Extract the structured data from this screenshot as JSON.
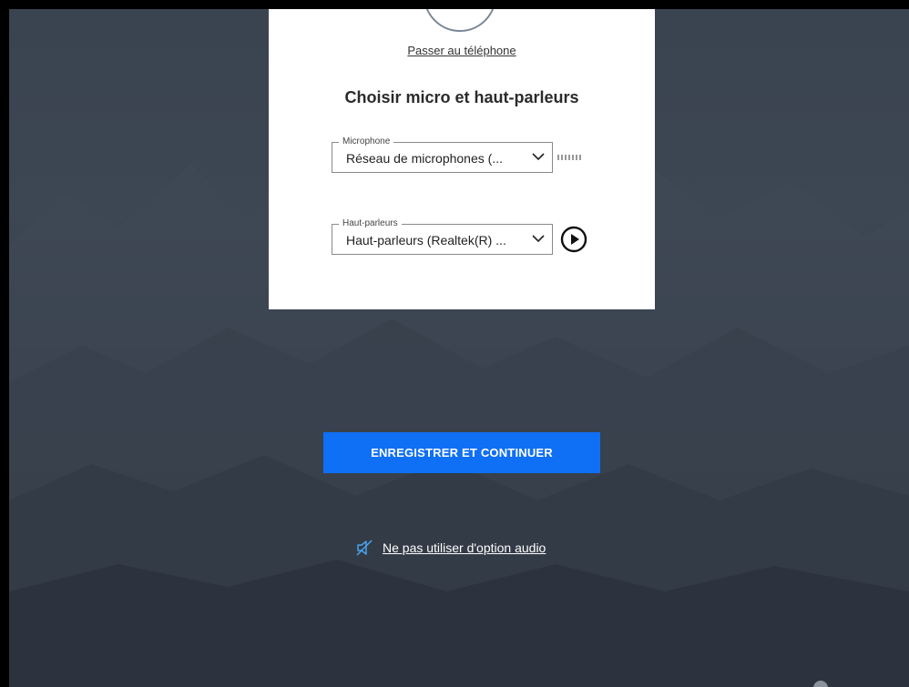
{
  "card": {
    "phone_link": "Passer au téléphone",
    "heading": "Choisir micro et haut-parleurs",
    "microphone": {
      "legend": "Microphone",
      "value": "Réseau de microphones (..."
    },
    "speakers": {
      "legend": "Haut-parleurs",
      "value": "Haut-parleurs (Realtek(R) ..."
    }
  },
  "actions": {
    "save_continue": "ENREGISTRER ET CONTINUER",
    "no_audio": "Ne pas utiliser d'option audio"
  },
  "icons": {
    "dropdown": "chevron-down-icon",
    "play": "play-icon",
    "no_audio": "speaker-muted-icon",
    "level": "level-meter-icon"
  },
  "colors": {
    "background": "#3a4350",
    "primary_button": "#0f6ff5",
    "card": "#ffffff"
  }
}
